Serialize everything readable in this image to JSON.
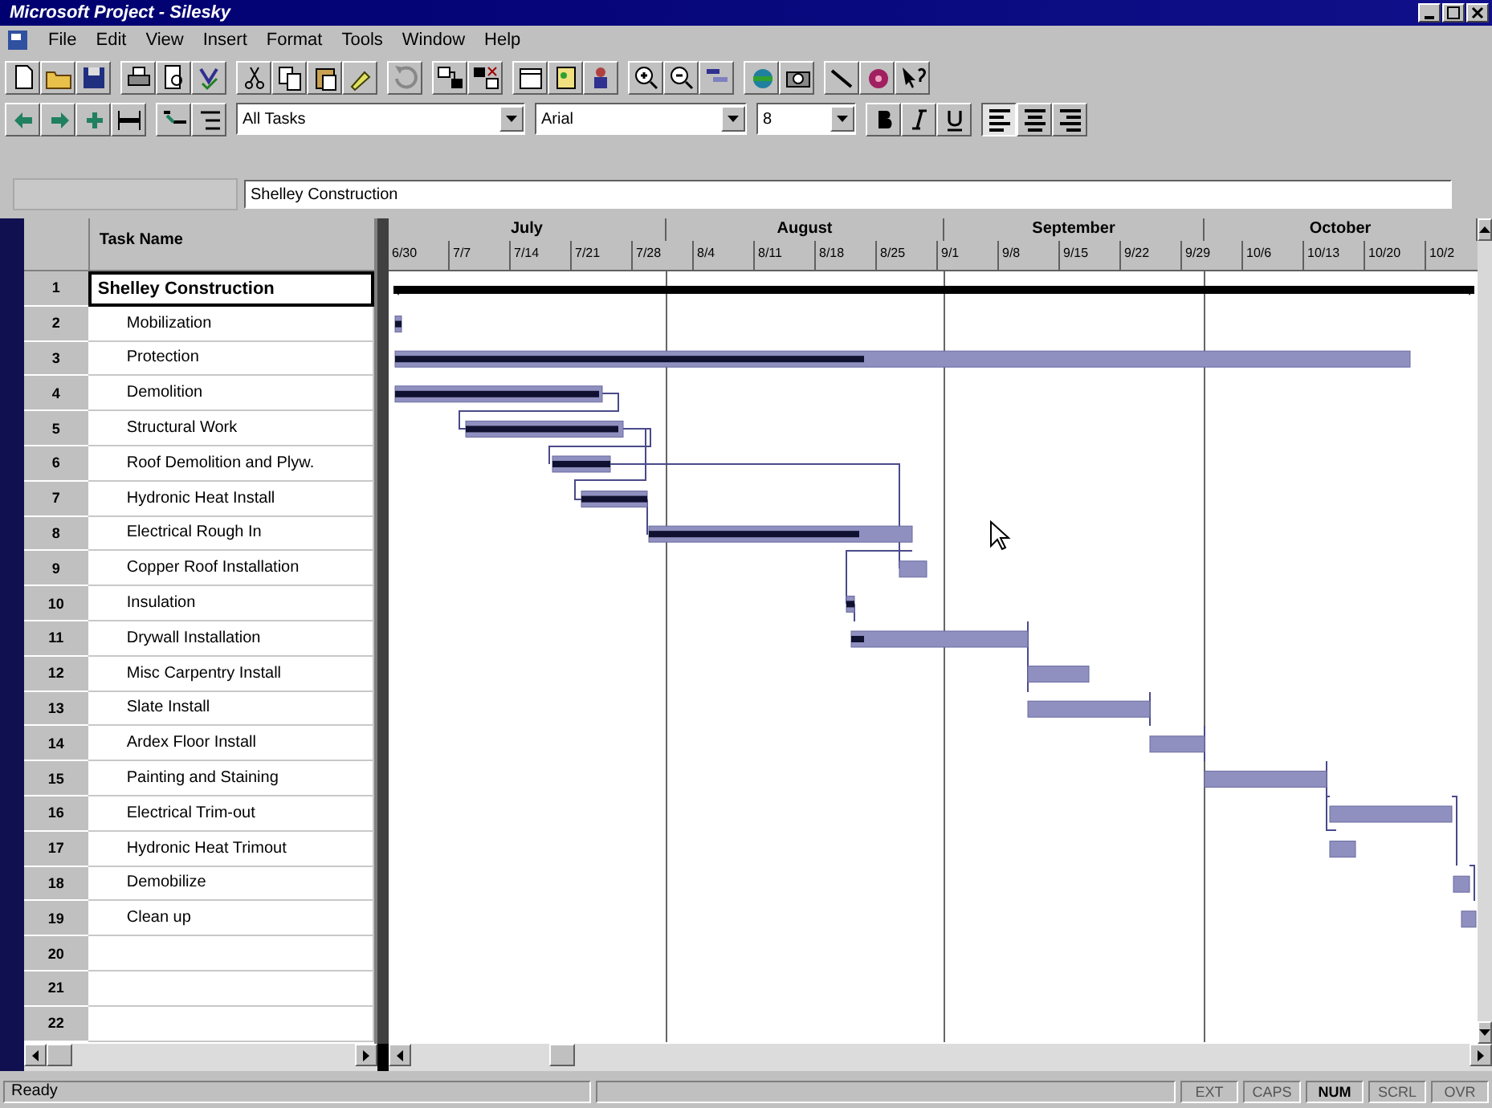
{
  "window": {
    "title": "Microsoft Project - Silesky"
  },
  "menu": [
    "File",
    "Edit",
    "View",
    "Insert",
    "Format",
    "Tools",
    "Window",
    "Help"
  ],
  "formatting": {
    "filter": "All Tasks",
    "font": "Arial",
    "size": "8",
    "alignment": [
      {
        "selected": true
      },
      {
        "selected": false
      },
      {
        "selected": false
      }
    ]
  },
  "entry_bar": {
    "value": "Shelley Construction"
  },
  "table": {
    "columns": [
      "Task Name"
    ],
    "rows": [
      {
        "id": "1",
        "name": "Shelley Construction",
        "kind": "summary",
        "selected": true
      },
      {
        "id": "2",
        "name": "Mobilization",
        "kind": "task",
        "selected": false
      },
      {
        "id": "3",
        "name": "Protection",
        "kind": "task",
        "selected": false
      },
      {
        "id": "4",
        "name": "Demolition",
        "kind": "task",
        "selected": false
      },
      {
        "id": "5",
        "name": "Structural Work",
        "kind": "task",
        "selected": false
      },
      {
        "id": "6",
        "name": "Roof Demolition and Plyw.",
        "kind": "task",
        "selected": false
      },
      {
        "id": "7",
        "name": "Hydronic Heat Install",
        "kind": "task",
        "selected": false
      },
      {
        "id": "8",
        "name": "Electrical Rough In",
        "kind": "task",
        "selected": false
      },
      {
        "id": "9",
        "name": "Copper Roof Installation",
        "kind": "task",
        "selected": false
      },
      {
        "id": "10",
        "name": "Insulation",
        "kind": "task",
        "selected": false
      },
      {
        "id": "11",
        "name": "Drywall Installation",
        "kind": "task",
        "selected": false
      },
      {
        "id": "12",
        "name": "Misc Carpentry Install",
        "kind": "task",
        "selected": false
      },
      {
        "id": "13",
        "name": "Slate Install",
        "kind": "task",
        "selected": false
      },
      {
        "id": "14",
        "name": "Ardex Floor Install",
        "kind": "task",
        "selected": false
      },
      {
        "id": "15",
        "name": "Painting and Staining",
        "kind": "task",
        "selected": false
      },
      {
        "id": "16",
        "name": "Electrical Trim-out",
        "kind": "task",
        "selected": false
      },
      {
        "id": "17",
        "name": "Hydronic Heat Trimout",
        "kind": "task",
        "selected": false
      },
      {
        "id": "18",
        "name": "Demobilize",
        "kind": "task",
        "selected": false
      },
      {
        "id": "19",
        "name": "Clean up",
        "kind": "task",
        "selected": false
      },
      {
        "id": "20",
        "kind": "task",
        "selected": false
      },
      {
        "id": "21",
        "kind": "task",
        "selected": false
      },
      {
        "id": "22",
        "kind": "task",
        "selected": false
      }
    ]
  },
  "timescale": {
    "months": [
      "July",
      "August",
      "September",
      "October"
    ],
    "weeks": [
      "6/30",
      "7/7",
      "7/14",
      "7/21",
      "7/28",
      "8/4",
      "8/11",
      "8/18",
      "8/25",
      "9/1",
      "9/8",
      "9/15",
      "9/22",
      "9/29",
      "10/6",
      "10/13",
      "10/20",
      "10/2"
    ]
  },
  "status_bar": {
    "text": "Ready",
    "indicators": [
      {
        "label": "EXT",
        "on": false
      },
      {
        "label": "CAPS",
        "on": false
      },
      {
        "label": "NUM",
        "on": true
      },
      {
        "label": "SCRL",
        "on": false
      },
      {
        "label": "OVR",
        "on": false
      }
    ]
  }
}
